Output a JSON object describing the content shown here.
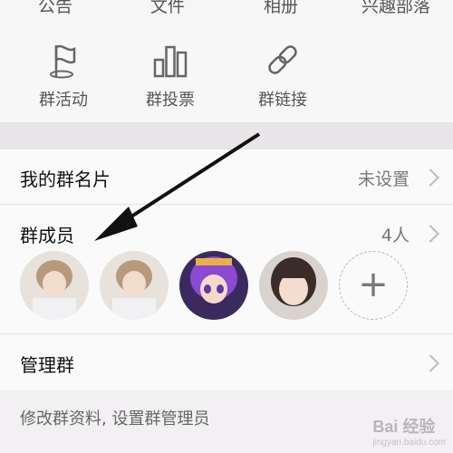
{
  "top_row": [
    "公告",
    "文件",
    "相册",
    "兴趣部落"
  ],
  "actions": [
    {
      "label": "群活动",
      "icon": "flag-icon"
    },
    {
      "label": "群投票",
      "icon": "bar-chart-icon"
    },
    {
      "label": "群链接",
      "icon": "link-icon"
    }
  ],
  "card": {
    "title": "我的群名片",
    "value": "未设置"
  },
  "members": {
    "title": "群成员",
    "count": "4人",
    "add_symbol": "+"
  },
  "manage": {
    "title": "管理群",
    "note": "修改群资料, 设置群管理员"
  },
  "watermark": {
    "brand": "Bai 经验",
    "url": "jingyan.baidu.com"
  }
}
